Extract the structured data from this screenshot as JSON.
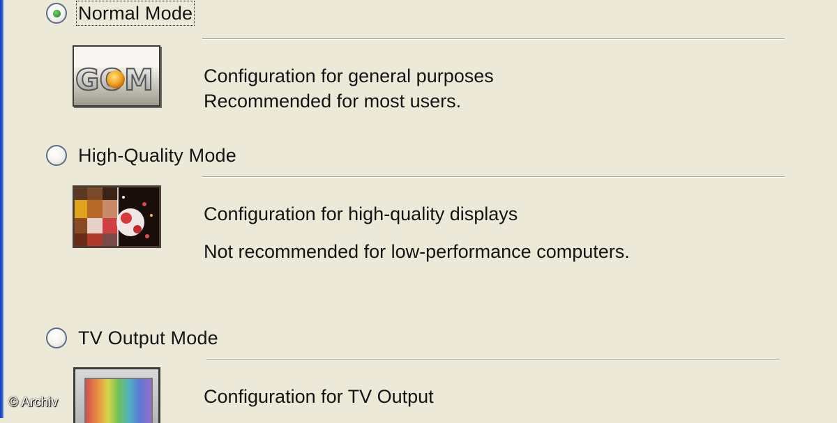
{
  "modes": [
    {
      "id": "normal",
      "label": "Normal Mode",
      "checked": true,
      "icon": "gom-logo-icon",
      "logo_text": "GOM",
      "description": [
        "Configuration for general purposes",
        "Recommended for most users."
      ]
    },
    {
      "id": "high-quality",
      "label": "High-Quality Mode",
      "checked": false,
      "icon": "high-quality-image-icon",
      "description": [
        "Configuration for high-quality displays",
        "Not recommended for low-performance computers."
      ]
    },
    {
      "id": "tv-output",
      "label": "TV Output Mode",
      "checked": false,
      "icon": "tv-icon",
      "description": [
        "Configuration for TV Output"
      ]
    }
  ],
  "watermark": "© Archiv",
  "colors": {
    "background": "#ece9d8",
    "window_border": "#2a5bd7",
    "radio_check": "#2f9b2f"
  }
}
